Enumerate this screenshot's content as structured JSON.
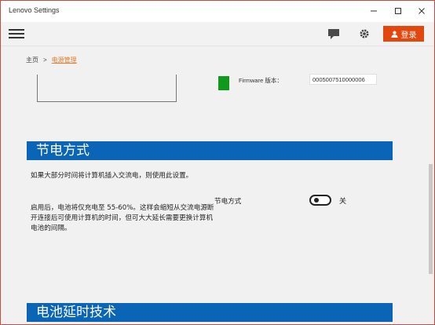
{
  "window": {
    "title": "Lenovo Settings"
  },
  "toolbar": {
    "login_label": "登录",
    "accent": "#e2470d"
  },
  "breadcrumb": {
    "home": "主页",
    "separator": ">",
    "current": "电源管理"
  },
  "firmware": {
    "label": "Firmware 版本：",
    "value": "0005007510000006",
    "badge_color": "#109a1b"
  },
  "battery_saver": {
    "header": "节电方式",
    "description_1": "如果大部分时间将计算机插入交流电，则使用此设置。",
    "description_2": "启用后，电池将仅充电至 55-60%。这样会缩短从交流电源断开连接后可使用计算机的时间，但可大大延长需要更换计算机电池的间隔。",
    "setting_label": "节电方式",
    "toggle_state": "关",
    "toggle_on": false
  },
  "battery_delay": {
    "header": "电池延时技术"
  },
  "colors": {
    "section_header": "#0b65b7",
    "breadcrumb_current": "#e87c2d"
  }
}
